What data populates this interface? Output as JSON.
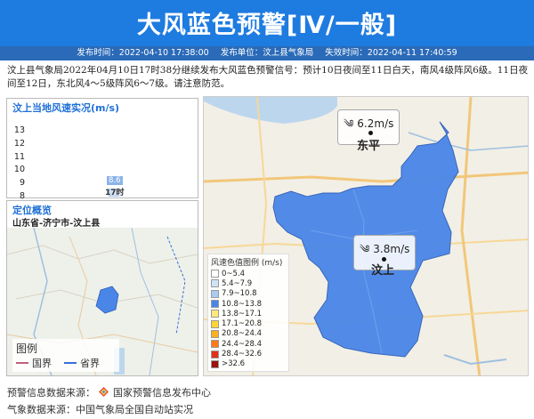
{
  "header": {
    "title": "大风蓝色预警[Ⅳ/一般]"
  },
  "meta": {
    "publish_time": "发布时间：2022-04-10 17:38:00",
    "publisher": "发布单位：汶上县气象局",
    "expire_time": "失效时间：2022-04-11 17:40:59"
  },
  "description": "汶上县气象局2022年04月10日17时38分继续发布大风蓝色预警信号：预计10日夜间至11日白天，南风4级阵风6级。11日夜间至12日，东北风4～5级阵风6～7级。请注意防范。",
  "speed_panel": {
    "title": "汶上当地风速实况(m/s)",
    "y_ticks": [
      "13",
      "12",
      "11",
      "10",
      "9",
      "8"
    ]
  },
  "chart_data": {
    "type": "bar",
    "title": "汶上当地风速实况(m/s)",
    "categories": [
      "17时"
    ],
    "values": [
      8.6
    ],
    "ylim": [
      8,
      13
    ]
  },
  "location_panel": {
    "title": "定位概览",
    "region": "山东省-济宁市-汶上县",
    "legend_title": "图例",
    "legend_items": [
      {
        "label": "国界",
        "color": "#c0607a"
      },
      {
        "label": "省界",
        "color": "#3a6fd8"
      }
    ]
  },
  "main_map": {
    "stations": [
      {
        "city": "东平",
        "wind": "6.2m/s"
      },
      {
        "city": "汶上",
        "wind": "3.8m/s"
      }
    ],
    "region_color": "#4a86e8",
    "scale_title": "风速色值图例 (m/s)",
    "scale": [
      {
        "label": "0~5.4",
        "color": "#ffffff"
      },
      {
        "label": "5.4~7.9",
        "color": "#cfe3f7"
      },
      {
        "label": "7.9~10.8",
        "color": "#a8cdf0"
      },
      {
        "label": "10.8~13.8",
        "color": "#4a86e8"
      },
      {
        "label": "13.8~17.1",
        "color": "#ffe97a"
      },
      {
        "label": "17.1~20.8",
        "color": "#ffd633"
      },
      {
        "label": "20.8~24.4",
        "color": "#ffb01f"
      },
      {
        "label": "24.4~28.4",
        "color": "#ff7a1a"
      },
      {
        "label": "28.4~32.6",
        "color": "#e0301e"
      },
      {
        "label": ">32.6",
        "color": "#9c1010"
      }
    ]
  },
  "footer": {
    "warning_source_label": "预警信息数据来源：",
    "warning_source": "国家预警信息发布中心",
    "weather_source": "气象数据来源：中国气象局全国自动站实况"
  }
}
